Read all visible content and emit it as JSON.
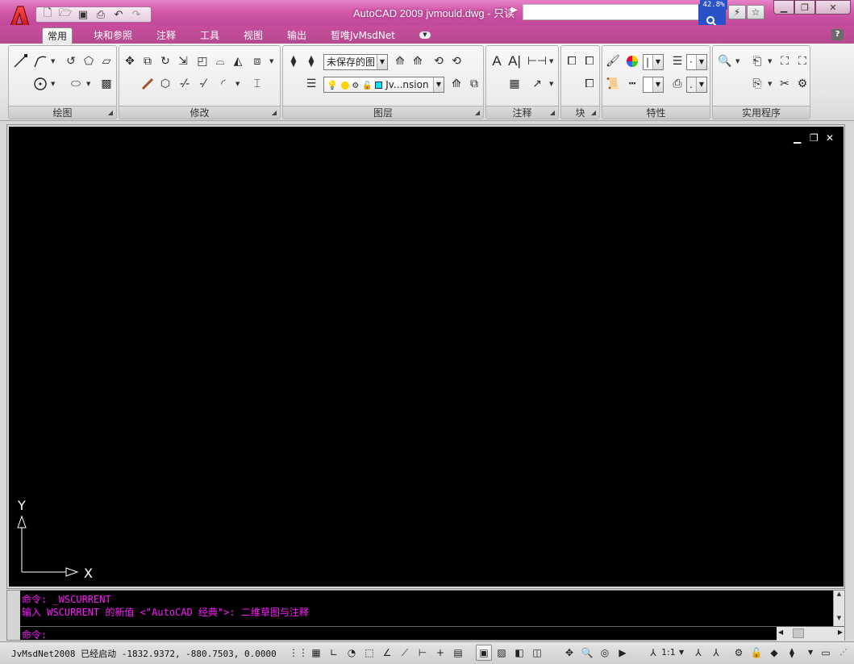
{
  "window": {
    "title": "AutoCAD 2009 jvmould.dwg - 只读",
    "search_placeholder": "",
    "zoom_readout": "42.8%"
  },
  "quick_access": [
    {
      "name": "new-icon",
      "glyph": "🗋"
    },
    {
      "name": "open-icon",
      "glyph": "📂"
    },
    {
      "name": "save-icon",
      "glyph": "💾"
    },
    {
      "name": "print-icon",
      "glyph": "🖶"
    },
    {
      "name": "undo-icon",
      "glyph": "↶"
    },
    {
      "name": "redo-icon",
      "glyph": "↷"
    }
  ],
  "tabs": [
    {
      "label": "常用",
      "active": true
    },
    {
      "label": "块和参照",
      "active": false
    },
    {
      "label": "注释",
      "active": false
    },
    {
      "label": "工具",
      "active": false
    },
    {
      "label": "视图",
      "active": false
    },
    {
      "label": "输出",
      "active": false
    },
    {
      "label": "晳唯JvMsdNet",
      "active": false
    }
  ],
  "help_label": "?",
  "panels": {
    "draw": "绘图",
    "modify": "修改",
    "layers": "图层",
    "annotation": "注释",
    "block": "块",
    "properties": "特性",
    "utilities": "实用程序"
  },
  "layer_state_combo": "未保存的图",
  "layer_combo": "Jv...nsion",
  "ucs": {
    "y_label": "Y",
    "x_label": "X"
  },
  "command": {
    "history": [
      "命令: _WSCURRENT",
      "输入 WSCURRENT 的新值 <\"AutoCAD 经典\">: 二维草图与注释"
    ],
    "prompt": "命令:"
  },
  "status": {
    "text": "JvMsdNet2008 已经启动  -1832.9372, -880.7503, 0.0000",
    "annotation_scale": "1:1"
  },
  "colors": {
    "titlebar": "#d25aa8",
    "command_text": "#ff1aff",
    "canvas": "#000000"
  }
}
